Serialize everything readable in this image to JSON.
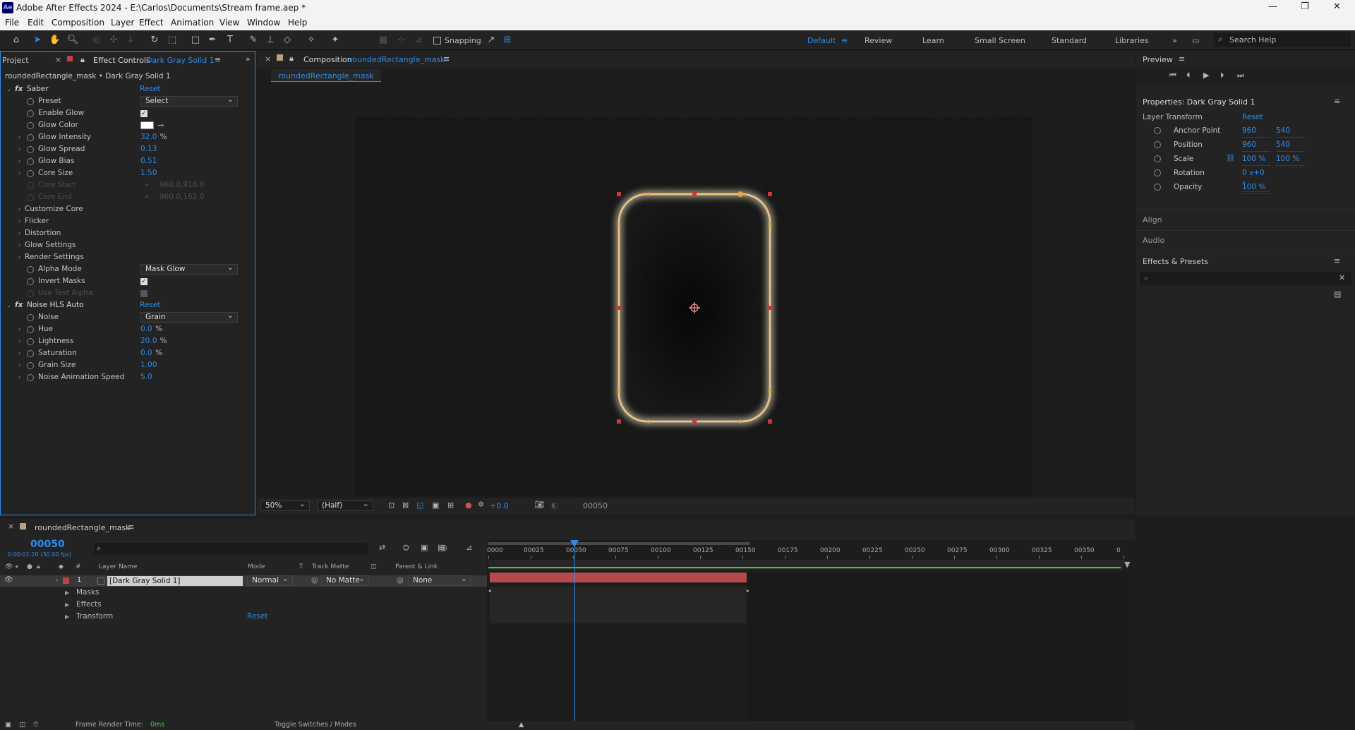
{
  "window": {
    "title": "Adobe After Effects 2024 - E:\\Carlos\\Documents\\Stream frame.aep *",
    "logo": "Ae",
    "min": "—",
    "max": "❐",
    "close": "✕"
  },
  "menu": [
    "File",
    "Edit",
    "Composition",
    "Layer",
    "Effect",
    "Animation",
    "View",
    "Window",
    "Help"
  ],
  "toolbar": {
    "snapping": "Snapping",
    "workspaces": [
      "Default",
      "Review",
      "Learn",
      "Small Screen",
      "Standard",
      "Libraries"
    ],
    "search": "Search Help"
  },
  "effect_controls": {
    "tab_project": "Project",
    "tab_label": "Effect Controls",
    "tab_layer": "Dark Gray Solid 1",
    "breadcrumb": "roundedRectangle_mask • Dark Gray Solid 1",
    "saber": {
      "name": "Saber",
      "reset": "Reset",
      "rows": [
        {
          "label": "Preset",
          "type": "dropdown",
          "value": "Select"
        },
        {
          "label": "Enable Glow",
          "type": "check",
          "value": "true"
        },
        {
          "label": "Glow Color",
          "type": "color",
          "value": ""
        },
        {
          "label": "Glow Intensity",
          "type": "num",
          "value": "32.0",
          "unit": "%",
          "expand": true
        },
        {
          "label": "Glow Spread",
          "type": "num",
          "value": "0.13",
          "unit": "",
          "expand": true
        },
        {
          "label": "Glow Bias",
          "type": "num",
          "value": "0.51",
          "unit": "",
          "expand": true
        },
        {
          "label": "Core Size",
          "type": "num",
          "value": "1.50",
          "unit": "",
          "expand": true
        },
        {
          "label": "Core Start",
          "type": "disabled",
          "value": "960.0,918.0"
        },
        {
          "label": "Core End",
          "type": "disabled",
          "value": "960.0,162.0"
        },
        {
          "label": "Customize Core",
          "type": "group"
        },
        {
          "label": "Flicker",
          "type": "group"
        },
        {
          "label": "Distortion",
          "type": "group"
        },
        {
          "label": "Glow Settings",
          "type": "group"
        },
        {
          "label": "Render Settings",
          "type": "group"
        },
        {
          "label": "Alpha Mode",
          "type": "dropdown",
          "value": "Mask Glow"
        },
        {
          "label": "Invert Masks",
          "type": "check",
          "value": "true"
        },
        {
          "label": "Use Text Alpha",
          "type": "disabledcheck",
          "value": ""
        }
      ]
    },
    "noise": {
      "name": "Noise HLS Auto",
      "reset": "Reset",
      "rows": [
        {
          "label": "Noise",
          "type": "dropdown",
          "value": "Grain"
        },
        {
          "label": "Hue",
          "type": "num",
          "value": "0.0",
          "unit": "%",
          "expand": true
        },
        {
          "label": "Lightness",
          "type": "num",
          "value": "20.0",
          "unit": "%",
          "expand": true
        },
        {
          "label": "Saturation",
          "type": "num",
          "value": "0.0",
          "unit": "%",
          "expand": true
        },
        {
          "label": "Grain Size",
          "type": "num",
          "value": "1.00",
          "unit": "",
          "expand": true
        },
        {
          "label": "Noise Animation Speed",
          "type": "num",
          "value": "5.0",
          "unit": "",
          "expand": true
        }
      ]
    }
  },
  "composition": {
    "tab_label": "Composition",
    "comp_name": "roundedRectangle_mask",
    "subtab": "roundedRectangle_mask",
    "zoom": "50%",
    "resolution": "(Half)",
    "exposure": "+0.0",
    "timecode": "00050"
  },
  "preview": {
    "title": "Preview"
  },
  "properties": {
    "title": "Properties: Dark Gray Solid 1",
    "section": "Layer Transform",
    "reset": "Reset",
    "rows": [
      {
        "label": "Anchor Point",
        "v1": "960",
        "v2": "540"
      },
      {
        "label": "Position",
        "v1": "960",
        "v2": "540"
      },
      {
        "label": "Scale",
        "v1": "100 %",
        "v2": "100 %"
      },
      {
        "label": "Rotation",
        "v1": "0 x+0 °",
        "v2": ""
      },
      {
        "label": "Opacity",
        "v1": "100 %",
        "v2": ""
      }
    ],
    "align": "Align",
    "audio": "Audio",
    "effects_presets": "Effects & Presets"
  },
  "timeline": {
    "comp_name": "roundedRectangle_mask",
    "timecode": "00050",
    "sub_timecode": "0:00:01:20 (30.00 fps)",
    "cols": {
      "num": "#",
      "layer_name": "Layer Name",
      "mode": "Mode",
      "t": "T",
      "track_matte": "Track Matte",
      "parent": "Parent & Link"
    },
    "layer": {
      "num": "1",
      "name": "[Dark Gray Solid 1]",
      "mode": "Normal",
      "matte": "No Matte",
      "parent": "None"
    },
    "sub": [
      "Masks",
      "Effects",
      "Transform"
    ],
    "transform_reset": "Reset",
    "ruler": [
      "0000",
      "00025",
      "00050",
      "00075",
      "00100",
      "00125",
      "00150",
      "00175",
      "00200",
      "00225",
      "00250",
      "00275",
      "00300",
      "00325",
      "00350",
      "0"
    ]
  },
  "statusbar": {
    "render_label": "Frame Render Time:",
    "render_value": "0ms",
    "toggle": "Toggle Switches / Modes"
  }
}
